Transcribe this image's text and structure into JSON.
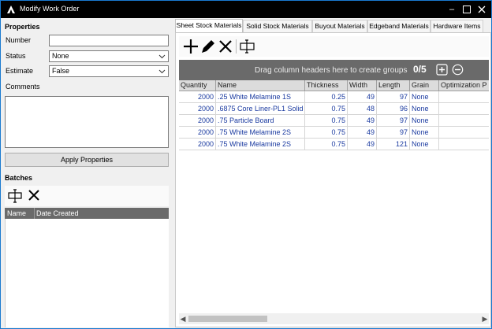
{
  "window": {
    "title": "Modify Work Order"
  },
  "properties": {
    "heading": "Properties",
    "number_label": "Number",
    "number_value": "",
    "status_label": "Status",
    "status_value": "None",
    "estimate_label": "Estimate",
    "estimate_value": "False",
    "comments_label": "Comments",
    "apply_label": "Apply Properties"
  },
  "batches": {
    "heading": "Batches",
    "columns": [
      "Name",
      "Date Created"
    ]
  },
  "tabs": [
    {
      "label": "Sheet Stock Materials",
      "active": true
    },
    {
      "label": "Solid Stock Materials",
      "active": false
    },
    {
      "label": "Buyout Materials",
      "active": false
    },
    {
      "label": "Edgeband Materials",
      "active": false
    },
    {
      "label": "Hardware Items",
      "active": false
    }
  ],
  "grouping": {
    "hint": "Drag column headers here to create groups",
    "count": "0/5"
  },
  "grid": {
    "columns": [
      "Quantity",
      "Name",
      "Thickness",
      "Width",
      "Length",
      "Grain",
      "Optimization P"
    ],
    "rows": [
      [
        "2000",
        ".25 White Melamine 1S",
        "0.25",
        "49",
        "97",
        "None",
        ""
      ],
      [
        "2000",
        ".6875 Core Liner-PL1 Solid",
        "0.75",
        "48",
        "96",
        "None",
        ""
      ],
      [
        "2000",
        ".75 Particle Board",
        "0.75",
        "49",
        "97",
        "None",
        ""
      ],
      [
        "2000",
        ".75 White Melamine 2S",
        "0.75",
        "49",
        "97",
        "None",
        ""
      ],
      [
        "2000",
        ".75 White Melamine 2S",
        "0.75",
        "49",
        "121",
        "None",
        ""
      ]
    ]
  },
  "colors": {
    "titlebar": "#000000",
    "accent_border": "#1a7ad0",
    "cell_text": "#1a3aa0",
    "group_bar": "#6a6a6a"
  }
}
